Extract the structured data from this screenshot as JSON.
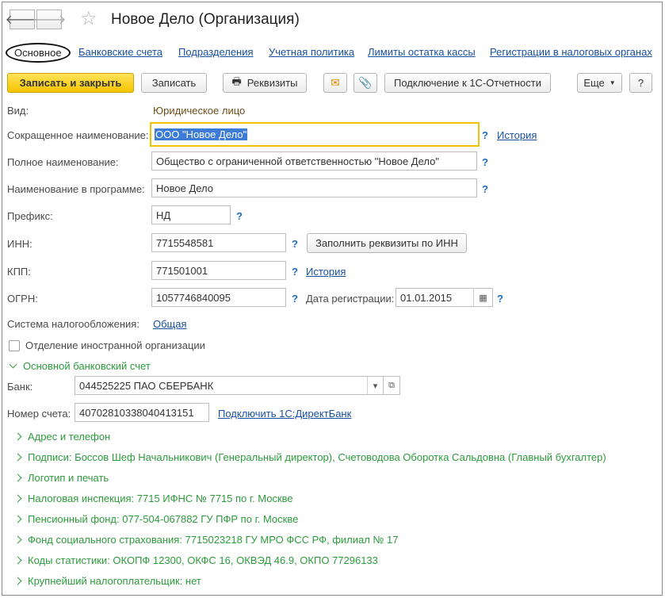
{
  "window": {
    "title": "Новое Дело (Организация)",
    "back_icon": "arrow-left-icon",
    "forward_icon": "arrow-right-icon",
    "favorite_icon": "star-icon"
  },
  "tabs": [
    {
      "label": "Основное",
      "active": true
    },
    {
      "label": "Банковские счета"
    },
    {
      "label": "Подразделения"
    },
    {
      "label": "Учетная политика"
    },
    {
      "label": "Лимиты остатка кассы"
    },
    {
      "label": "Регистрации в налоговых органах"
    }
  ],
  "toolbar": {
    "save_close": "Записать и закрыть",
    "save": "Записать",
    "requisites": "Реквизиты",
    "connect": "Подключение к 1С-Отчетности",
    "more": "Еще",
    "help": "?"
  },
  "form": {
    "vid_label": "Вид:",
    "vid_value": "Юридическое лицо",
    "short_name_label": "Сокращенное наименование:",
    "short_name_value": "ООО \"Новое Дело\"",
    "history_label": "История",
    "full_name_label": "Полное наименование:",
    "full_name_value": "Общество с ограниченной ответственностью \"Новое Дело\"",
    "prog_name_label": "Наименование в программе:",
    "prog_name_value": "Новое Дело",
    "prefix_label": "Префикс:",
    "prefix_value": "НД",
    "inn_label": "ИНН:",
    "inn_value": "7715548581",
    "fill_by_inn": "Заполнить реквизиты по ИНН",
    "kpp_label": "КПП:",
    "kpp_value": "771501001",
    "kpp_history": "История",
    "ogrn_label": "ОГРН:",
    "ogrn_value": "1057746840095",
    "reg_date_label": "Дата регистрации:",
    "reg_date_value": "01.01.2015",
    "tax_system_label": "Система налогообложения:",
    "tax_system_value": "Общая",
    "foreign_org_label": "Отделение иностранной организации",
    "q": "?"
  },
  "bank": {
    "group_label": "Основной банковский счет",
    "bank_label": "Банк:",
    "bank_value": "044525225 ПАО СБЕРБАНК",
    "account_label": "Номер счета:",
    "account_value": "40702810338040413151",
    "direct_bank_link": "Подключить 1С:ДиректБанк"
  },
  "groups": [
    "Адрес и телефон",
    "Подписи: Боссов Шеф Начальникович (Генеральный директор), Счетоводова Оборотка Сальдовна (Главный бухгалтер)",
    "Логотип и печать",
    "Налоговая инспекция: 7715 ИФНС № 7715 по г. Москве",
    "Пенсионный фонд: 077-504-067882 ГУ ПФР по г. Москве",
    "Фонд социального страхования: 7715023218 ГУ МРО ФСС РФ, филиал № 17",
    "Коды статистики: ОКОПФ 12300, ОКФС 16, ОКВЭД 46.9, ОКПО 77296133",
    "Крупнейший налогоплательщик: нет"
  ],
  "colors": {
    "accent_yellow": "#f5c400",
    "link_blue": "#1a4fa0",
    "group_green": "#2e9a3c",
    "selection_blue": "#3c7bd6"
  }
}
